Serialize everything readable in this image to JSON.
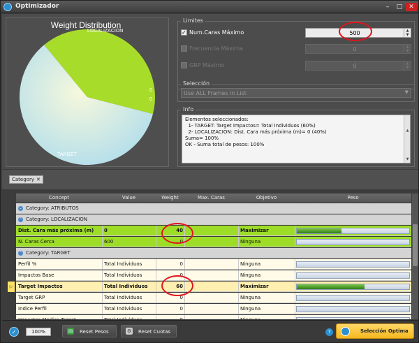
{
  "window": {
    "title": "Optimizador"
  },
  "chart": {
    "title": "Weight Distribution",
    "slice_labels": [
      {
        "text": "LOCALIZACION"
      },
      {
        "text": "0"
      },
      {
        "text": "0"
      },
      {
        "text": "TARGET"
      }
    ],
    "colors": {
      "localizacion": "#a8dc2a",
      "target": "#b7e0ee",
      "cream": "#f4f6d8"
    }
  },
  "limites": {
    "title": "Limites",
    "rows": [
      {
        "label": "Num.Caras Máximo",
        "value": "500",
        "checked": true,
        "enabled": true
      },
      {
        "label": "Frecuencia Máxima",
        "value": "0",
        "checked": false,
        "enabled": false
      },
      {
        "label": "GRP Máximo",
        "value": "0",
        "checked": false,
        "enabled": false
      }
    ]
  },
  "seleccion": {
    "title": "Selección",
    "value": "Use ALL Frames in List"
  },
  "info": {
    "title": "Info",
    "lines": [
      "Elementos seleccionados:",
      "  1- TARGET: Target Impactos= Total Individuos (60%)",
      "  2- LOCALIZACION: Dist. Cara más próxima (m)= 0 (40%)",
      "",
      "Suma= 100%",
      "OK - Suma total de pesos: 100%"
    ]
  },
  "grid": {
    "group_chip": "Category",
    "columns": [
      "Concept",
      "Value",
      "Weight",
      "Max. Caras",
      "Objetivo",
      "Peso"
    ],
    "rows": [
      {
        "kind": "cat",
        "label": "Category: ATRIBUTOS",
        "toggle": "⌄"
      },
      {
        "kind": "cat",
        "label": "Category: LOCALIZACION",
        "toggle": "⌃"
      },
      {
        "kind": "data",
        "style": "green",
        "concept": "Dist. Cara más próxima (m)",
        "value": "0",
        "weight": "40",
        "max_caras": "",
        "objetivo": "Maximizar",
        "peso": 0.4,
        "bold": true
      },
      {
        "kind": "data",
        "style": "green",
        "concept": "N. Caras Cerca",
        "value": "600",
        "weight": "0",
        "max_caras": "",
        "objetivo": "Ninguna",
        "peso": 0,
        "bold": false
      },
      {
        "kind": "cat",
        "label": "Category: TARGET",
        "toggle": "⌃"
      },
      {
        "kind": "data",
        "style": "",
        "concept": "Perfil %",
        "value": "Total Individuos",
        "weight": "0",
        "max_caras": "",
        "objetivo": "Ninguna",
        "peso": 0,
        "bold": false
      },
      {
        "kind": "data",
        "style": "",
        "concept": "Impactos Base",
        "value": "Total Individuos",
        "weight": "0",
        "max_caras": "",
        "objetivo": "Ninguna",
        "peso": 0,
        "bold": false
      },
      {
        "kind": "data",
        "style": "sel",
        "concept": "Target Impactos",
        "value": "Total Individuos",
        "weight": "60",
        "max_caras": "",
        "objetivo": "Maximizar",
        "peso": 0.6,
        "bold": true
      },
      {
        "kind": "data",
        "style": "",
        "concept": "Target GRP",
        "value": "Total Individuos",
        "weight": "0",
        "max_caras": "",
        "objetivo": "Ninguna",
        "peso": 0,
        "bold": false
      },
      {
        "kind": "data",
        "style": "",
        "concept": "Indice Perfil",
        "value": "Total Individuos",
        "weight": "0",
        "max_caras": "",
        "objetivo": "Ninguna",
        "peso": 0,
        "bold": false
      },
      {
        "kind": "data",
        "style": "",
        "concept": "Impactos Medios Target",
        "value": "Total Individuos",
        "weight": "0",
        "max_caras": "",
        "objetivo": "Ninguna",
        "peso": 0,
        "bold": false
      }
    ]
  },
  "bottom": {
    "zoom": "100%",
    "reset_pesos": "Reset Pesos",
    "reset_cuotas": "Reset Cuotas",
    "seleccion_optima": "Selección Optima"
  },
  "chart_data": {
    "type": "pie",
    "title": "Weight Distribution",
    "categories": [
      "LOCALIZACION",
      "TARGET"
    ],
    "values": [
      40,
      60
    ],
    "colors": [
      "#a8dc2a",
      "#b7e0ee"
    ]
  }
}
